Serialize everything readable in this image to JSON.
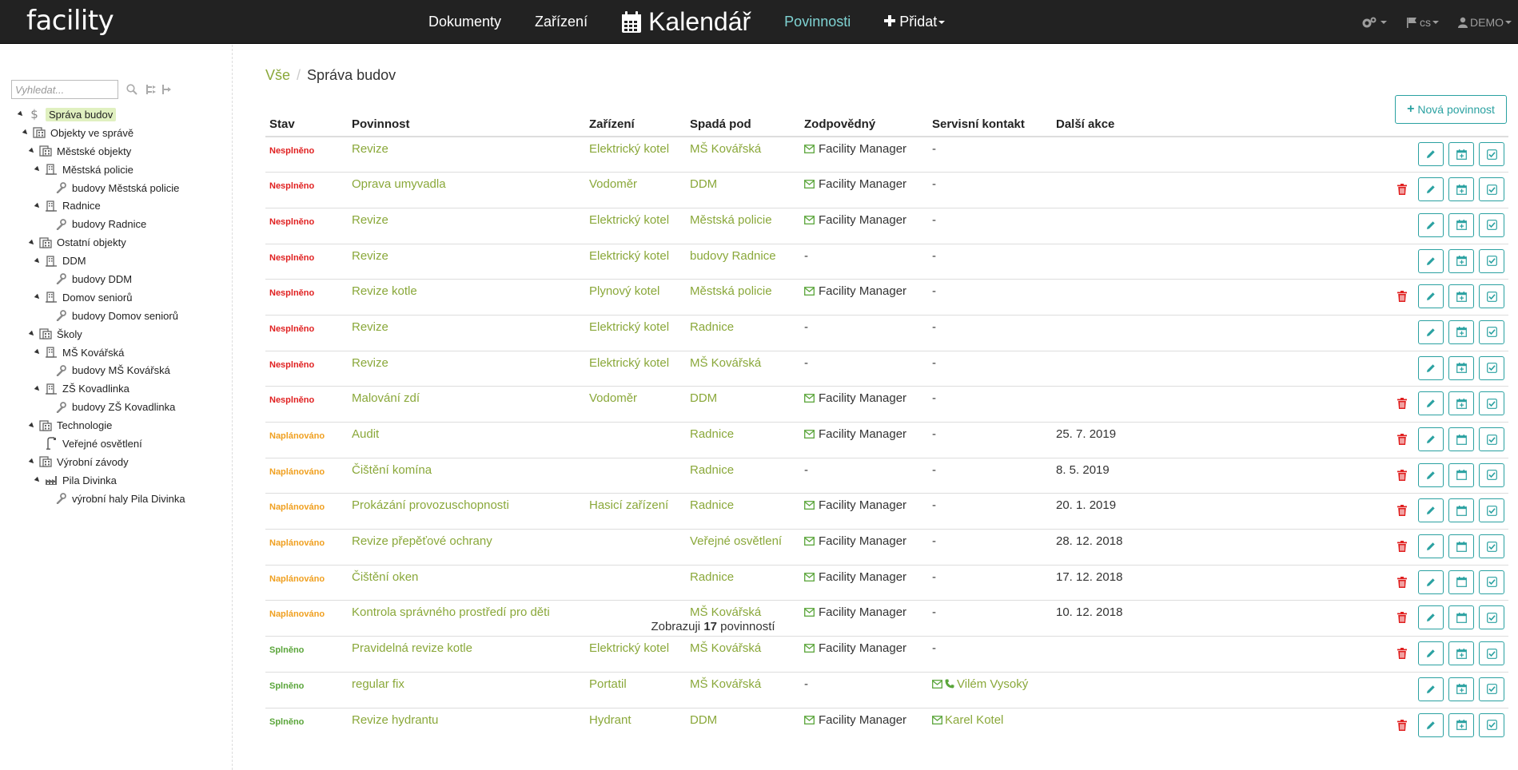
{
  "nav": {
    "logo": "facility",
    "links": [
      "Dokumenty",
      "Zařízení"
    ],
    "calendar": "Kalendář",
    "active": "Povinnosti",
    "add": "Přidat",
    "lang": "cs",
    "user": "DEMO"
  },
  "sidebar": {
    "search_placeholder": "Vyhledat...",
    "tree": [
      {
        "label": "Správa budov",
        "level": 0,
        "icon": "dollar-icon",
        "toggle": true,
        "selected": true
      },
      {
        "label": "Objekty ve správě",
        "level": 1,
        "icon": "buildings-icon",
        "toggle": true
      },
      {
        "label": "Městské objekty",
        "level": 2,
        "icon": "buildings-icon",
        "toggle": true
      },
      {
        "label": "Městská policie",
        "level": 3,
        "icon": "building-icon",
        "toggle": true
      },
      {
        "label": "budovy Městská policie",
        "level": 4,
        "icon": "wrench-icon",
        "toggle": false
      },
      {
        "label": "Radnice",
        "level": 3,
        "icon": "building-icon",
        "toggle": true
      },
      {
        "label": "budovy Radnice",
        "level": 4,
        "icon": "wrench-icon",
        "toggle": false
      },
      {
        "label": "Ostatní objekty",
        "level": 2,
        "icon": "buildings-icon",
        "toggle": true
      },
      {
        "label": "DDM",
        "level": 3,
        "icon": "building-icon",
        "toggle": true
      },
      {
        "label": "budovy DDM",
        "level": 4,
        "icon": "wrench-icon",
        "toggle": false
      },
      {
        "label": "Domov seniorů",
        "level": 3,
        "icon": "building-icon",
        "toggle": true
      },
      {
        "label": "budovy Domov seniorů",
        "level": 4,
        "icon": "wrench-icon",
        "toggle": false
      },
      {
        "label": "Školy",
        "level": 2,
        "icon": "buildings-icon",
        "toggle": true
      },
      {
        "label": "MŠ Kovářská",
        "level": 3,
        "icon": "building-icon",
        "toggle": true
      },
      {
        "label": "budovy MŠ Kovářská",
        "level": 4,
        "icon": "wrench-icon",
        "toggle": false
      },
      {
        "label": "ZŠ Kovadlinka",
        "level": 3,
        "icon": "building-icon",
        "toggle": true
      },
      {
        "label": "budovy ZŠ Kovadlinka",
        "level": 4,
        "icon": "wrench-icon",
        "toggle": false
      },
      {
        "label": "Technologie",
        "level": 2,
        "icon": "buildings-icon",
        "toggle": true
      },
      {
        "label": "Veřejné osvětlení",
        "level": 3,
        "icon": "streetlight-icon",
        "toggle": false
      },
      {
        "label": "Výrobní závody",
        "level": 2,
        "icon": "buildings-icon",
        "toggle": true
      },
      {
        "label": "Pila Divinka",
        "level": 3,
        "icon": "factory-icon",
        "toggle": true
      },
      {
        "label": "výrobní haly Pila Divinka",
        "level": 4,
        "icon": "wrench-icon",
        "toggle": false
      }
    ]
  },
  "breadcrumb": {
    "root": "Vše",
    "current": "Správa budov"
  },
  "new_button": "Nová povinnost",
  "table": {
    "headers": [
      "Stav",
      "Povinnost",
      "Zařízení",
      "Spadá pod",
      "Zodpovědný",
      "Servisní kontakt",
      "Další akce"
    ],
    "rows": [
      {
        "stav": "Nesplněno",
        "cls": "s-nesplneno",
        "povinnost": "Revize",
        "zarizeni": "Elektrický kotel",
        "spada": "MŠ Kovářská",
        "zodpovedny": "Facility Manager",
        "kontakt": "-",
        "kontakt_type": "none",
        "dalsi": "",
        "trash": false,
        "cal": "plus"
      },
      {
        "stav": "Nesplněno",
        "cls": "s-nesplneno",
        "povinnost": "Oprava umyvadla",
        "zarizeni": "Vodoměr",
        "spada": "DDM",
        "zodpovedny": "Facility Manager",
        "kontakt": "-",
        "kontakt_type": "none",
        "dalsi": "",
        "trash": true,
        "cal": "plus"
      },
      {
        "stav": "Nesplněno",
        "cls": "s-nesplneno",
        "povinnost": "Revize",
        "zarizeni": "Elektrický kotel",
        "spada": "Městská policie",
        "zodpovedny": "Facility Manager",
        "kontakt": "-",
        "kontakt_type": "none",
        "dalsi": "",
        "trash": false,
        "cal": "plus"
      },
      {
        "stav": "Nesplněno",
        "cls": "s-nesplneno",
        "povinnost": "Revize",
        "zarizeni": "Elektrický kotel",
        "spada": "budovy Radnice",
        "zodpovedny": "-",
        "kontakt": "-",
        "kontakt_type": "none",
        "dalsi": "",
        "trash": false,
        "cal": "plus"
      },
      {
        "stav": "Nesplněno",
        "cls": "s-nesplneno",
        "povinnost": "Revize kotle",
        "zarizeni": "Plynový kotel",
        "spada": "Městská policie",
        "zodpovedny": "Facility Manager",
        "kontakt": "-",
        "kontakt_type": "none",
        "dalsi": "",
        "trash": true,
        "cal": "plus"
      },
      {
        "stav": "Nesplněno",
        "cls": "s-nesplneno",
        "povinnost": "Revize",
        "zarizeni": "Elektrický kotel",
        "spada": "Radnice",
        "zodpovedny": "-",
        "kontakt": "-",
        "kontakt_type": "none",
        "dalsi": "",
        "trash": false,
        "cal": "plus"
      },
      {
        "stav": "Nesplněno",
        "cls": "s-nesplneno",
        "povinnost": "Revize",
        "zarizeni": "Elektrický kotel",
        "spada": "MŠ Kovářská",
        "zodpovedny": "-",
        "kontakt": "-",
        "kontakt_type": "none",
        "dalsi": "",
        "trash": false,
        "cal": "plus"
      },
      {
        "stav": "Nesplněno",
        "cls": "s-nesplneno",
        "povinnost": "Malování zdí",
        "zarizeni": "Vodoměr",
        "spada": "DDM",
        "zodpovedny": "Facility Manager",
        "kontakt": "-",
        "kontakt_type": "none",
        "dalsi": "",
        "trash": true,
        "cal": "plus"
      },
      {
        "stav": "Naplánováno",
        "cls": "s-naplanovano",
        "povinnost": "Audit",
        "zarizeni": "",
        "spada": "Radnice",
        "zodpovedny": "Facility Manager",
        "kontakt": "-",
        "kontakt_type": "none",
        "dalsi": "25. 7. 2019",
        "trash": true,
        "cal": "plain"
      },
      {
        "stav": "Naplánováno",
        "cls": "s-naplanovano",
        "povinnost": "Čištění komína",
        "zarizeni": "",
        "spada": "Radnice",
        "zodpovedny": "-",
        "kontakt": "-",
        "kontakt_type": "none",
        "dalsi": "8. 5. 2019",
        "trash": true,
        "cal": "plain"
      },
      {
        "stav": "Naplánováno",
        "cls": "s-naplanovano",
        "povinnost": "Prokázání provozuschopnosti",
        "zarizeni": "Hasicí zařízení",
        "spada": "Radnice",
        "zodpovedny": "Facility Manager",
        "kontakt": "-",
        "kontakt_type": "none",
        "dalsi": "20. 1. 2019",
        "trash": true,
        "cal": "plain"
      },
      {
        "stav": "Naplánováno",
        "cls": "s-naplanovano",
        "povinnost": "Revize přepěťové ochrany",
        "zarizeni": "",
        "spada": "Veřejné osvětlení",
        "zodpovedny": "Facility Manager",
        "kontakt": "-",
        "kontakt_type": "none",
        "dalsi": "28. 12. 2018",
        "trash": true,
        "cal": "plain"
      },
      {
        "stav": "Naplánováno",
        "cls": "s-naplanovano",
        "povinnost": "Čištění oken",
        "zarizeni": "",
        "spada": "Radnice",
        "zodpovedny": "Facility Manager",
        "kontakt": "-",
        "kontakt_type": "none",
        "dalsi": "17. 12. 2018",
        "trash": true,
        "cal": "plain"
      },
      {
        "stav": "Naplánováno",
        "cls": "s-naplanovano",
        "povinnost": "Kontrola správného prostředí pro děti",
        "zarizeni": "",
        "spada": "MŠ Kovářská",
        "zodpovedny": "Facility Manager",
        "kontakt": "-",
        "kontakt_type": "none",
        "dalsi": "10. 12. 2018",
        "trash": true,
        "cal": "plain"
      },
      {
        "stav": "Splněno",
        "cls": "s-splneno",
        "povinnost": "Pravidelná revize kotle",
        "zarizeni": "Elektrický kotel",
        "spada": "MŠ Kovářská",
        "zodpovedny": "Facility Manager",
        "kontakt": "-",
        "kontakt_type": "none",
        "dalsi": "",
        "trash": true,
        "cal": "plus"
      },
      {
        "stav": "Splněno",
        "cls": "s-splneno",
        "povinnost": "regular fix",
        "zarizeni": "Portatil",
        "spada": "MŠ Kovářská",
        "zodpovedny": "-",
        "kontakt": "Vilém Vysoký",
        "kontakt_type": "mailphone",
        "dalsi": "",
        "trash": false,
        "cal": "plus"
      },
      {
        "stav": "Splněno",
        "cls": "s-splneno",
        "povinnost": "Revize hydrantu",
        "zarizeni": "Hydrant",
        "spada": "DDM",
        "zodpovedny": "Facility Manager",
        "kontakt": "Karel Kotel",
        "kontakt_type": "mail",
        "dalsi": "",
        "trash": true,
        "cal": "plus"
      }
    ]
  },
  "footer": {
    "prefix": "Zobrazuji",
    "count": "17",
    "suffix": "povinností"
  },
  "colors": {
    "accent": "#2aa1a1",
    "link": "#8aa83a",
    "danger": "#e02020",
    "planned": "#f0a020",
    "done": "#5aa53a",
    "navbar": "#222222"
  }
}
